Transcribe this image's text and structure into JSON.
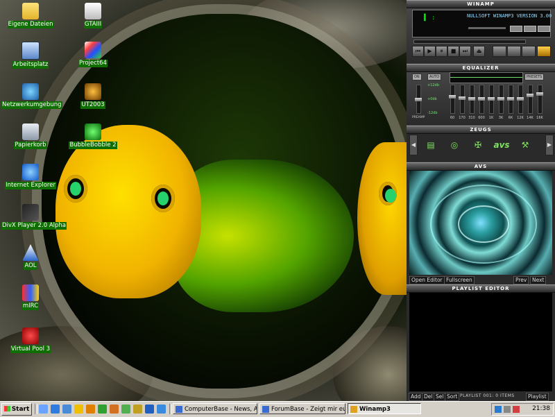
{
  "desktop": {
    "icons_left": [
      {
        "label": "Eigene Dateien",
        "icon": "folder-icon"
      },
      {
        "label": "Arbeitsplatz",
        "icon": "computer-icon"
      },
      {
        "label": "Netzwerkumgebung",
        "icon": "network-icon"
      },
      {
        "label": "Papierkorb",
        "icon": "recycle-bin-icon"
      },
      {
        "label": "Internet Explorer",
        "icon": "ie-icon"
      },
      {
        "label": "DivX Player 2.0 Alpha",
        "icon": "divx-icon"
      },
      {
        "label": "AOL",
        "icon": "aol-icon"
      },
      {
        "label": "mIRC",
        "icon": "mirc-icon"
      },
      {
        "label": "Virtual Pool 3",
        "icon": "pool-icon"
      }
    ],
    "icons_right": [
      {
        "label": "GTAIII",
        "icon": "gta-icon"
      },
      {
        "label": "Project64",
        "icon": "project64-icon"
      },
      {
        "label": "UT2003",
        "icon": "ut-icon"
      },
      {
        "label": "BubbleBobble 2",
        "icon": "bubblebobble-icon"
      }
    ]
  },
  "winamp": {
    "main": {
      "title": "WINAMP",
      "song_text": "NULLSOFT WINAMP3 VERSION 3.00",
      "time": "▌ :"
    },
    "equalizer": {
      "title": "EQUALIZER",
      "buttons": {
        "on": "ON",
        "auto": "AUTO",
        "presets": "PRESETS"
      },
      "db_labels": [
        "+12db",
        "+0db",
        "-12db"
      ],
      "preamp_label": "PREAMP",
      "bands": [
        "60",
        "170",
        "310",
        "600",
        "1K",
        "3K",
        "6K",
        "12K",
        "14K",
        "16K"
      ]
    },
    "zeugs": {
      "title": "ZEUGS",
      "items": [
        "playlist-icon",
        "visualization-icon",
        "tools-icon",
        "avs",
        "wrench-icon"
      ]
    },
    "avs": {
      "title": "AVS",
      "open_editor": "Open Editor",
      "fullscreen": "Fullscreen",
      "prev": "Prev",
      "next": "Next"
    },
    "playlist": {
      "title": "PLAYLIST EDITOR",
      "buttons": {
        "add": "Add",
        "del": "Del",
        "sel": "Sel",
        "sort": "Sort",
        "playlist": "Playlist"
      },
      "info": "PLAYLIST 001: 0 ITEMS"
    }
  },
  "taskbar": {
    "start_label": "Start",
    "tasks": [
      {
        "label": "ComputerBase - News, Ar..."
      },
      {
        "label": "ForumBase - Zeigt mir eur..."
      },
      {
        "label": "Winamp3"
      }
    ],
    "clock": "21:38"
  }
}
